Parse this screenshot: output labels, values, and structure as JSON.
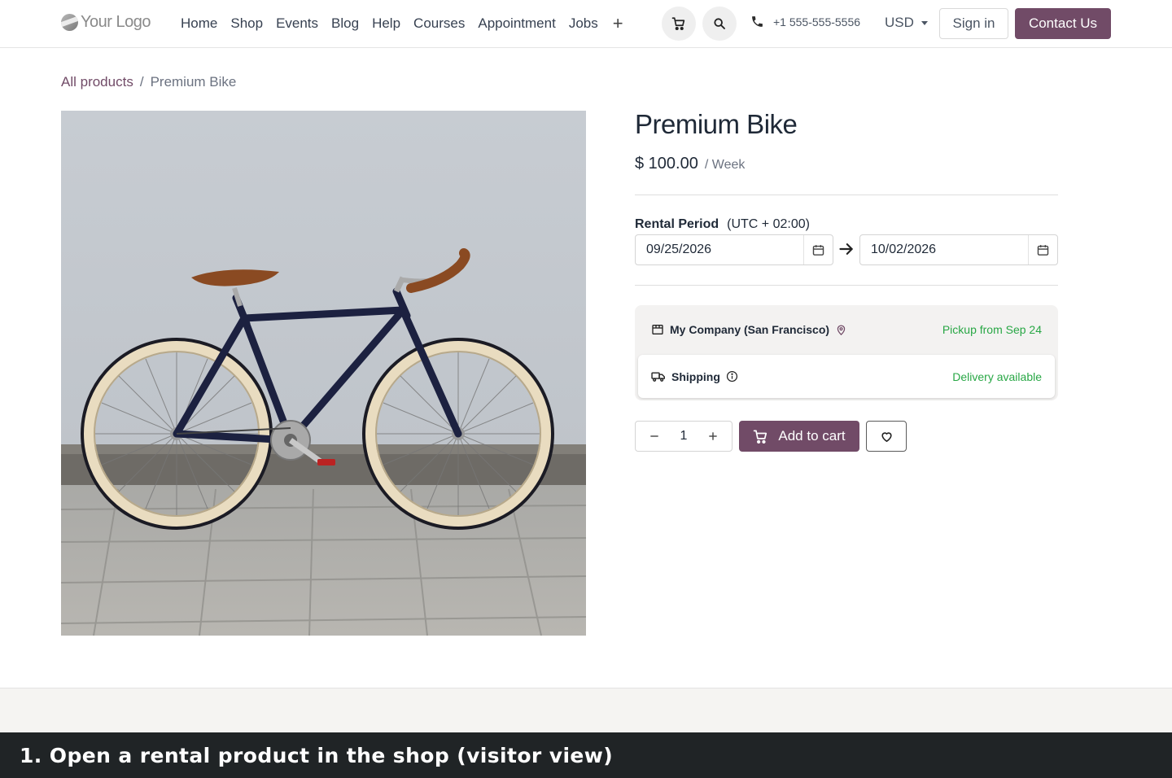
{
  "header": {
    "logo_text": "Your Logo",
    "nav": [
      "Home",
      "Shop",
      "Events",
      "Blog",
      "Help",
      "Courses",
      "Appointment",
      "Jobs"
    ],
    "nav_more": "+",
    "phone": "+1 555-555-5556",
    "currency": "USD",
    "signin_label": "Sign in",
    "contact_label": "Contact Us"
  },
  "breadcrumb": {
    "parent": "All products",
    "separator": "/",
    "current": "Premium Bike"
  },
  "product": {
    "title": "Premium Bike",
    "price": "$ 100.00",
    "price_unit": "/ Week",
    "rental_label": "Rental Period",
    "timezone": "(UTC + 02:00)",
    "start_date": "09/25/2026",
    "end_date": "10/02/2026",
    "pickup": {
      "location": "My Company (San Francisco)",
      "status": "Pickup from Sep 24"
    },
    "shipping": {
      "label": "Shipping",
      "status": "Delivery available"
    },
    "quantity": "1",
    "add_to_cart_label": "Add to cart"
  },
  "caption": "1. Open a rental product in the shop (visitor view)",
  "colors": {
    "brand": "#714b67",
    "success": "#28a745",
    "caption_bg": "#202426"
  },
  "icons": [
    "cart-icon",
    "search-icon",
    "phone-icon",
    "calendar-icon",
    "arrow-right-icon",
    "store-icon",
    "map-pin-icon",
    "truck-icon",
    "info-icon",
    "minus-icon",
    "plus-icon",
    "heart-icon"
  ]
}
